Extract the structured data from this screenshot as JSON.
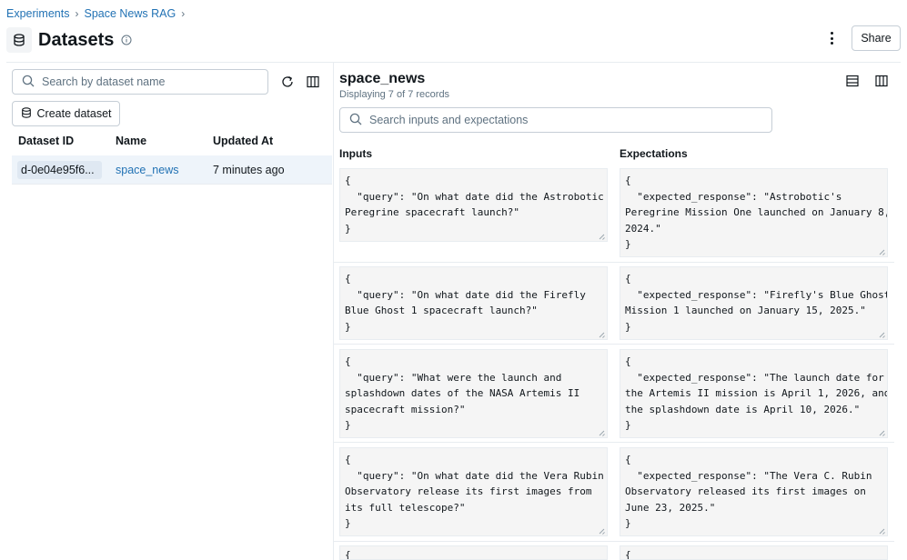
{
  "breadcrumb": {
    "items": [
      "Experiments",
      "Space News RAG"
    ],
    "separator": "›"
  },
  "header": {
    "title": "Datasets",
    "share_label": "Share"
  },
  "left_panel": {
    "search_placeholder": "Search by dataset name",
    "create_label": "Create dataset",
    "columns": [
      "Dataset ID",
      "Name",
      "Updated At"
    ],
    "rows": [
      {
        "id": "d-0e04e95f6...",
        "name": "space_news",
        "updated": "7 minutes ago"
      }
    ]
  },
  "right_panel": {
    "title": "space_news",
    "subtitle": "Displaying 7 of 7 records",
    "search_placeholder": "Search inputs and expectations",
    "col_inputs": "Inputs",
    "col_expectations": "Expectations",
    "records": [
      {
        "input": "{\n  \"query\": \"On what date did the Astrobotic\nPeregrine spacecraft launch?\"\n}",
        "expectation": "{\n  \"expected_response\": \"Astrobotic's\nPeregrine Mission One launched on January 8,\n2024.\"\n}"
      },
      {
        "input": "{\n  \"query\": \"On what date did the Firefly\nBlue Ghost 1 spacecraft launch?\"\n}",
        "expectation": "{\n  \"expected_response\": \"Firefly's Blue Ghost\nMission 1 launched on January 15, 2025.\"\n}"
      },
      {
        "input": "{\n  \"query\": \"What were the launch and\nsplashdown dates of the NASA Artemis II\nspacecraft mission?\"\n}",
        "expectation": "{\n  \"expected_response\": \"The launch date for\nthe Artemis II mission is April 1, 2026, and\nthe splashdown date is April 10, 2026.\"\n}"
      },
      {
        "input": "{\n  \"query\": \"On what date did the Vera Rubin\nObservatory release its first images from\nits full telescope?\"\n}",
        "expectation": "{\n  \"expected_response\": \"The Vera C. Rubin\nObservatory released its first images on\nJune 23, 2025.\"\n}"
      },
      {
        "input": "{",
        "expectation": "{"
      }
    ]
  }
}
